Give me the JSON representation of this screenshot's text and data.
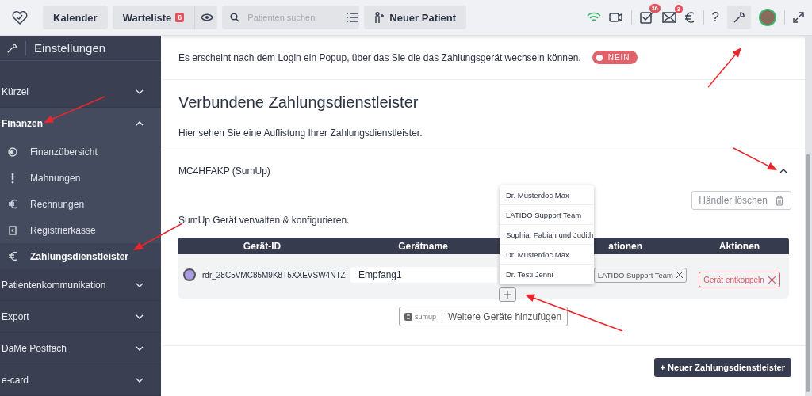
{
  "topbar": {
    "calendar": "Kalender",
    "waitlist": {
      "label": "Warteliste",
      "count": "6"
    },
    "search": {
      "placeholder": "Patienten suchen"
    },
    "new_patient": "Neuer Patient",
    "tasks_badge": "36",
    "mail_badge": "3",
    "help": "?",
    "settings": {
      "selected": true
    }
  },
  "sidebar": {
    "title": "Einstellungen",
    "items": [
      {
        "label": "Kürzel",
        "expanded": false
      },
      {
        "label": "Finanzen",
        "expanded": true,
        "children": [
          {
            "label": "Finanzübersicht",
            "kind": "overview",
            "selected": false
          },
          {
            "label": "Mahnungen",
            "kind": "alert",
            "selected": false
          },
          {
            "label": "Rechnungen",
            "kind": "euro",
            "selected": false
          },
          {
            "label": "Registrierkasse",
            "kind": "register",
            "selected": false
          },
          {
            "label": "Zahlungsdienstleister",
            "kind": "euro",
            "selected": true
          }
        ]
      },
      {
        "label": "Patientenkommunikation",
        "expanded": false
      },
      {
        "label": "Export",
        "expanded": false
      },
      {
        "label": "DaMe Postfach",
        "expanded": false
      },
      {
        "label": "e-card",
        "expanded": false
      }
    ]
  },
  "main": {
    "login_popup": {
      "text": "Es erscheint nach dem Login ein Popup, über das Sie die das Zahlungsgerät wechseln können.",
      "toggle": {
        "label": "NEIN",
        "on": false
      }
    },
    "title": "Verbundene Zahlungsdienstleister",
    "description": "Hier sehen Sie eine Auflistung Ihrer Zahlungsdienstleister.",
    "providers": [
      {
        "name": "MC4HFAKP (SumUp)",
        "expanded": true,
        "delete_button": "Händler löschen",
        "description": "SumUp Gerät verwalten & konfigurieren.",
        "table": {
          "columns": [
            "Gerät-ID",
            "Gerätname",
            "ationen",
            "Aktionen"
          ],
          "rows": [
            {
              "color": "#ab9de3",
              "id": "rdr_28C5VMC85M9K8T5XXEVSW4NTZ",
              "name": "Empfang1",
              "tags": [
                "LATIDO Support Team"
              ],
              "action": "Gerät entkoppeln"
            }
          ]
        },
        "dropdown": [
          "Dr. Musterdoc Max",
          "LATIDO Support Team",
          "Sophia, Fabian und Judith",
          "Dr. Musterdoc Max",
          "Dr. Testi Jenni"
        ],
        "add_device": {
          "brand": "sumup",
          "label": "Weitere Geräte hinzufügen"
        }
      }
    ],
    "new_provider_button": "+ Neuer Zahlungsdienstleister"
  }
}
